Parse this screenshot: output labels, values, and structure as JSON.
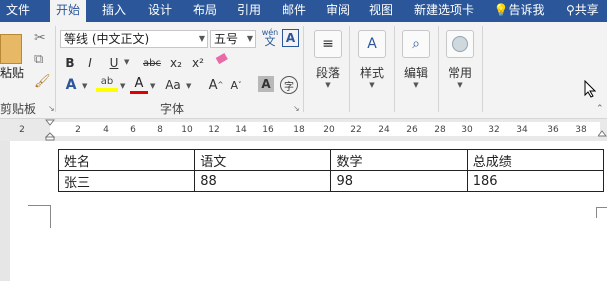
{
  "tabs": [
    "文件",
    "开始",
    "插入",
    "设计",
    "布局",
    "引用",
    "邮件",
    "审阅",
    "视图",
    "新建选项卡"
  ],
  "tell_me": "告诉我",
  "share": "共享",
  "clipboard": {
    "paste_label": "粘贴",
    "group_label": "剪贴板"
  },
  "font": {
    "name": "等线 (中文正文)",
    "size": "五号",
    "group_label": "字体",
    "pinyin_top": "wén",
    "pinyin_bottom": "文"
  },
  "groups": {
    "paragraph": "段落",
    "styles": "样式",
    "editing": "编辑",
    "common": "常用"
  },
  "format_buttons": {
    "bold": "B",
    "italic": "I",
    "underline": "U",
    "strike": "abc",
    "sub": "x₂",
    "sup": "x²",
    "grow": "A",
    "shrink": "A",
    "clear_format": "Aa",
    "border_char": "A",
    "enclose": "字"
  },
  "ruler_ticks": [
    "2",
    "2",
    "4",
    "6",
    "8",
    "10",
    "12",
    "14",
    "16",
    "18",
    "20",
    "22",
    "24",
    "26",
    "28",
    "30",
    "32",
    "34",
    "36",
    "38"
  ],
  "table": {
    "rows": [
      [
        "姓名",
        "语文",
        "数学",
        "总成绩"
      ],
      [
        "张三",
        "88",
        "98",
        "186"
      ]
    ]
  },
  "colors": {
    "accent": "#2b579a",
    "ribbon_bg": "#f3f3f3",
    "highlight": "#ffff00",
    "font_color": "#e00000"
  }
}
